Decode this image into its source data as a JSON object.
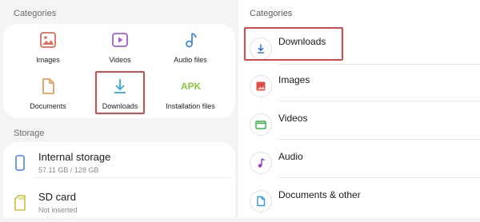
{
  "left": {
    "categories_title": "Categories",
    "categories": [
      {
        "label": "Images",
        "icon": "image-icon"
      },
      {
        "label": "Videos",
        "icon": "video-icon"
      },
      {
        "label": "Audio files",
        "icon": "audio-icon"
      },
      {
        "label": "Documents",
        "icon": "document-icon"
      },
      {
        "label": "Downloads",
        "icon": "download-icon",
        "highlighted": true
      },
      {
        "label": "Installation files",
        "icon": "apk-icon",
        "badge": "APK"
      }
    ],
    "storage_title": "Storage",
    "storage": [
      {
        "name": "Internal storage",
        "detail": "57.11 GB / 128 GB",
        "icon": "phone-icon"
      },
      {
        "name": "SD card",
        "detail": "Not inserted",
        "icon": "sd-card-icon"
      }
    ]
  },
  "right": {
    "categories_title": "Categories",
    "items": [
      {
        "label": "Downloads",
        "icon": "download-icon",
        "highlighted": true
      },
      {
        "label": "Images",
        "icon": "image-icon"
      },
      {
        "label": "Videos",
        "icon": "video-icon"
      },
      {
        "label": "Audio",
        "icon": "music-note-icon"
      },
      {
        "label": "Documents & other",
        "icon": "document-icon"
      }
    ]
  },
  "colors": {
    "highlight": "#d94848",
    "images": "#e06a5c",
    "videos": "#a55bd8",
    "audio": "#4a86e0",
    "documents": "#e0a060",
    "downloads": "#2eaed9",
    "apk": "#8cc63f"
  }
}
